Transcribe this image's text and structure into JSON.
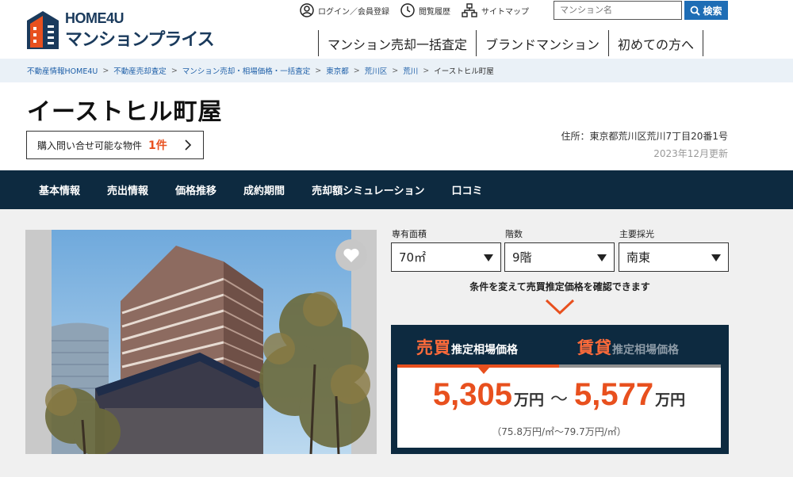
{
  "logo": {
    "top": "HOME4U",
    "bottom": "マンションプライス"
  },
  "toplinks": [
    {
      "label": "ログイン／会員登録",
      "icon": "user-circle-icon"
    },
    {
      "label": "閲覧履歴",
      "icon": "clock-icon"
    },
    {
      "label": "サイトマップ",
      "icon": "sitemap-icon"
    }
  ],
  "search": {
    "placeholder": "マンション名",
    "button_label": "検索"
  },
  "mainnav": [
    "マンション売却一括査定",
    "ブランドマンション",
    "初めての方へ"
  ],
  "breadcrumb": [
    "不動産情報HOME4U",
    "不動産売却査定",
    "マンション売却・相場価格・一括査定",
    "東京都",
    "荒川区",
    "荒川",
    "イーストヒル町屋"
  ],
  "property": {
    "title": "イーストヒル町屋",
    "inquiry_label": "購入問い合せ可能な物件",
    "inquiry_count": "1件",
    "address": "住所：東京都荒川区荒川7丁目20番1号",
    "updated": "2023年12月更新"
  },
  "tabs": [
    "基本情報",
    "売出情報",
    "価格推移",
    "成約期間",
    "売却額シミュレーション",
    "口コミ"
  ],
  "conditions": {
    "area_label": "専有面積",
    "area_value": "70㎡",
    "floor_label": "階数",
    "floor_value": "9階",
    "light_label": "主要採光",
    "light_value": "南東",
    "hint": "条件を変えて売買推定価格を確認できます"
  },
  "price": {
    "sell_tab_big": "売買",
    "sell_tab_small": "推定相場価格",
    "rent_tab_big": "賃貸",
    "rent_tab_small": "推定相場価格",
    "low": "5,305",
    "high": "5,577",
    "unit": "万円",
    "tilde": "〜",
    "per_sqm": "（75.8万円/㎡〜79.7万円/㎡）"
  },
  "colors": {
    "accent": "#e8501e",
    "navy": "#0d2a40",
    "link": "#1e5fa8",
    "search_button": "#1e6db5"
  }
}
